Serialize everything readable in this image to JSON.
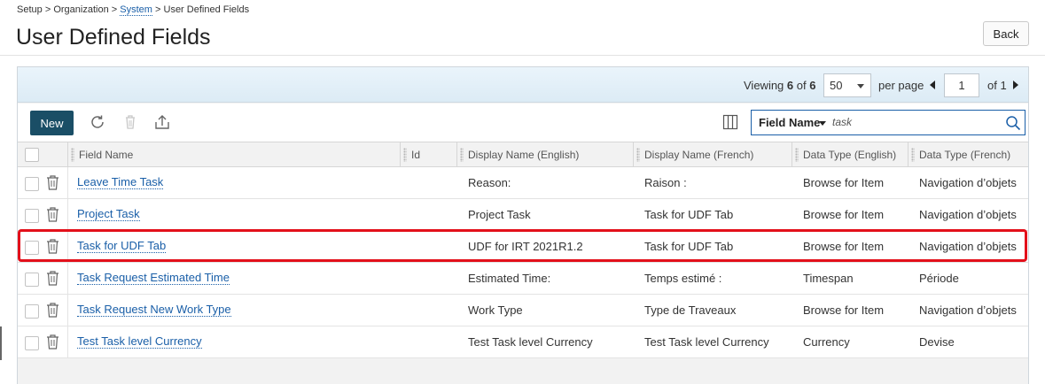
{
  "breadcrumb": {
    "setup": "Setup",
    "sep1": ">",
    "organization": "Organization",
    "sep2": ">",
    "system": "System",
    "sep3": ">",
    "current": "User Defined Fields"
  },
  "page": {
    "title": "User Defined Fields",
    "back_label": "Back"
  },
  "pager": {
    "viewing_label": "Viewing",
    "shown": "6",
    "of_label": "of",
    "total": "6",
    "page_size": "50",
    "per_page_label": "per page",
    "current_page": "1",
    "of_pages_label": "of 1"
  },
  "toolbar": {
    "new_label": "New",
    "icons": [
      "refresh-icon",
      "trash-icon",
      "export-icon",
      "columns-icon"
    ]
  },
  "search": {
    "field_label": "Field Name",
    "value": "task"
  },
  "columns": [
    "Field Name",
    "Id",
    "Display Name (English)",
    "Display Name (French)",
    "Data Type (English)",
    "Data Type (French)"
  ],
  "rows": [
    {
      "field_name": "Leave Time Task",
      "id": "",
      "display_en": "Reason:",
      "display_fr": "Raison :",
      "type_en": "Browse for Item",
      "type_fr": "Navigation d’objets"
    },
    {
      "field_name": "Project Task",
      "id": "",
      "display_en": "Project Task",
      "display_fr": "Task for UDF Tab",
      "type_en": "Browse for Item",
      "type_fr": "Navigation d’objets"
    },
    {
      "field_name": "Task for UDF Tab",
      "id": "",
      "display_en": "UDF for IRT 2021R1.2",
      "display_fr": "Task for UDF Tab",
      "type_en": "Browse for Item",
      "type_fr": "Navigation d’objets"
    },
    {
      "field_name": "Task Request Estimated Time",
      "id": "",
      "display_en": "Estimated Time:",
      "display_fr": "Temps estimé :",
      "type_en": "Timespan",
      "type_fr": "Période"
    },
    {
      "field_name": "Task Request New Work Type",
      "id": "",
      "display_en": "Work Type",
      "display_fr": "Type de Traveaux",
      "type_en": "Browse for Item",
      "type_fr": "Navigation d’objets"
    },
    {
      "field_name": "Test Task level Currency",
      "id": "",
      "display_en": "Test Task level Currency",
      "display_fr": "Test Task level Currency",
      "type_en": "Currency",
      "type_fr": "Devise"
    }
  ],
  "colors": {
    "accent": "#1a4e66",
    "link": "#1a5fa8",
    "highlight": "#e3101a"
  }
}
